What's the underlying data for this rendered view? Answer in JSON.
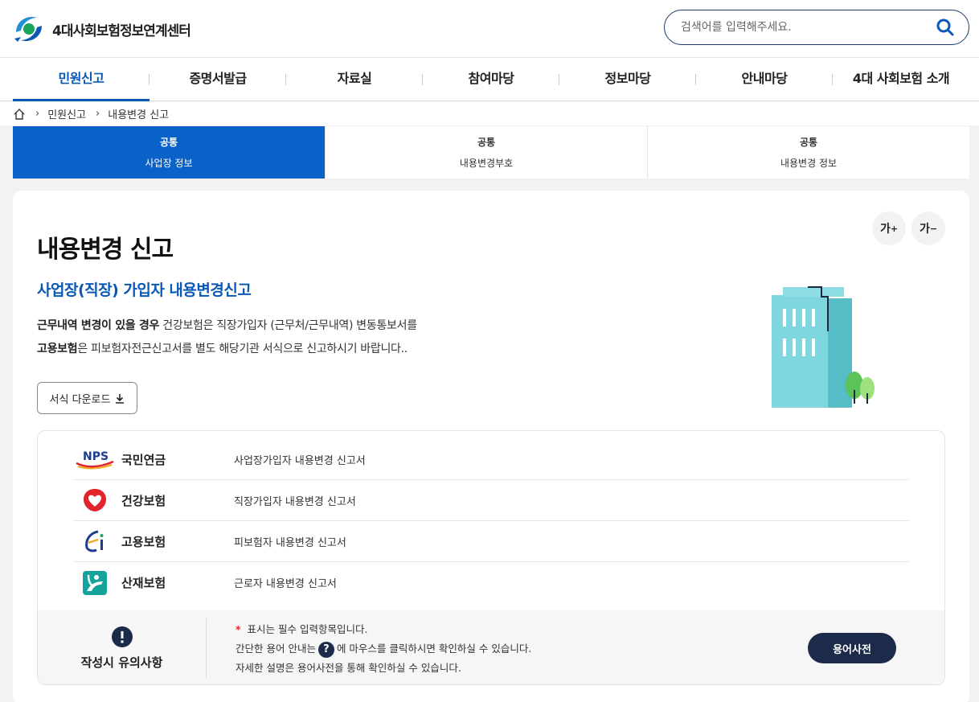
{
  "header": {
    "logo_text": "4대사회보험정보연계센터",
    "search_placeholder": "검색어를 입력해주세요."
  },
  "nav": {
    "items": [
      "민원신고",
      "증명서발급",
      "자료실",
      "참여마당",
      "정보마당",
      "안내마당",
      "4대 사회보험 소개"
    ],
    "active_index": 0
  },
  "breadcrumb": {
    "items": [
      "민원신고",
      "내용변경 신고"
    ]
  },
  "steps": [
    {
      "line1": "공통",
      "line2": "사업장 정보",
      "active": true
    },
    {
      "line1": "공통",
      "line2": "내용변경부호",
      "active": false
    },
    {
      "line1": "공통",
      "line2": "내용변경 정보",
      "active": false
    }
  ],
  "font_controls": {
    "increase_label": "가",
    "decrease_label": "가"
  },
  "main": {
    "title": "내용변경 신고",
    "subtitle": "사업장(직장) 가입자 내용변경신고",
    "desc_line1_bold": "근무내역 변경이 있을 경우",
    "desc_line1_rest": " 건강보험은 직장가입자 (근무처/근무내역) 변동통보서를",
    "desc_line2_bold": "고용보험",
    "desc_line2_rest": "은 피보험자전근신고서를 별도 해당기관 서식으로 신고하시기 바랍니다..",
    "download_label": "서식 다운로드"
  },
  "insurances": [
    {
      "logo": "nps-logo",
      "logo_text": "NPS",
      "name": "국민연금",
      "form": "사업장가입자 내용변경 신고서"
    },
    {
      "logo": "nhis-logo",
      "name": "건강보험",
      "form": "직장가입자 내용변경 신고서"
    },
    {
      "logo": "employment-logo",
      "name": "고용보험",
      "form": "피보험자 내용변경 신고서"
    },
    {
      "logo": "comwel-logo",
      "name": "산재보험",
      "form": "근로자 내용변경 신고서"
    }
  ],
  "notice": {
    "label": "작성시 유의사항",
    "required_mark": "*",
    "line1": " 표시는 필수 입력항목입니다.",
    "line2_pre": "간단한 용어 안내는",
    "line2_q": "?",
    "line2_post": "에 마우스를 클릭하시면 확인하실 수 있습니다.",
    "line3": "자세한 설명은 용어사전을 통해 확인하실 수 있습니다.",
    "dict_button": "용어사전"
  },
  "colors": {
    "primary": "#0a58b5",
    "active_tab": "#0a62c9",
    "dark_navy": "#1d2b4a",
    "required": "#e0262c"
  }
}
